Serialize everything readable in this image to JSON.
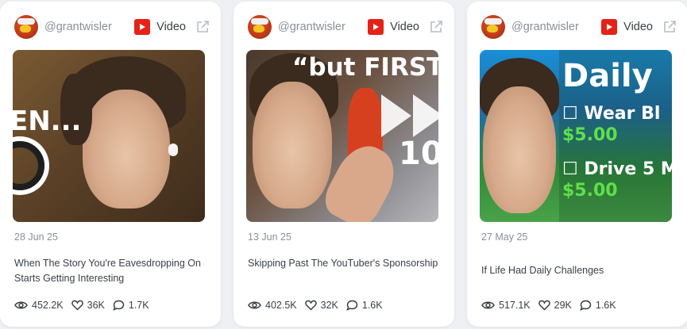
{
  "cards": [
    {
      "handle": "@grantwisler",
      "type_label": "Video",
      "thumbnail_text": [
        "EN..."
      ],
      "date": "28 Jun 25",
      "title": "When The Story You're Eavesdropping On Starts Getting Interesting",
      "views": "452.2K",
      "likes": "36K",
      "comments": "1.7K"
    },
    {
      "handle": "@grantwisler",
      "type_label": "Video",
      "thumbnail_text": [
        "“but FIRST",
        "10"
      ],
      "date": "13 Jun 25",
      "title": "Skipping Past The YouTuber's Sponsorship",
      "views": "402.5K",
      "likes": "32K",
      "comments": "1.6K"
    },
    {
      "handle": "@grantwisler",
      "type_label": "Video",
      "thumbnail_text": [
        "Daily",
        "☐ Wear Bl",
        "$5.00",
        "☐ Drive 5 M",
        "$5.00"
      ],
      "date": "27 May 25",
      "title": "If Life Had Daily Challenges",
      "views": "517.1K",
      "likes": "29K",
      "comments": "1.6K"
    }
  ],
  "colors": {
    "background": "#eef0f3",
    "card": "#ffffff",
    "youtube_red": "#e62117",
    "muted_text": "#8a8f98",
    "body_text": "#3a3f47",
    "thumb_green_text": "#5fe04a"
  },
  "icons": {
    "platform": "youtube-icon",
    "external": "external-link-icon",
    "views": "eye-icon",
    "likes": "heart-icon",
    "comments": "comment-icon"
  }
}
